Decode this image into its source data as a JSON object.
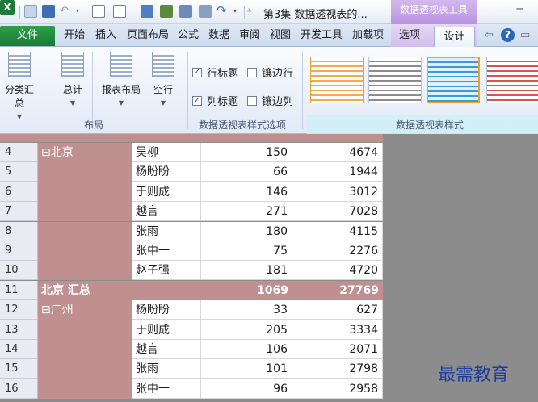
{
  "titlebar": {
    "app_icon": "X",
    "document_title": "第3集 数据透视表的...",
    "context_group": "数据透视表工具",
    "minimize": "−"
  },
  "tabs": {
    "file": "文件",
    "home": "开始",
    "insert": "插入",
    "page_layout": "页面布局",
    "formulas": "公式",
    "data": "数据",
    "review": "审阅",
    "view": "视图",
    "developer": "开发工具",
    "addins": "加载项",
    "options": "选项",
    "design": "设计"
  },
  "ribbon": {
    "subtotals": "分类汇总",
    "grand_totals": "总计",
    "report_layout": "报表布局",
    "blank_rows": "空行",
    "layout_group": "布局",
    "row_headers": "行标题",
    "banded_rows": "镶边行",
    "column_headers": "列标题",
    "banded_columns": "镶边列",
    "style_options_group": "数据透视表样式选项",
    "styles_group": "数据透视表样式",
    "row_headers_checked": true,
    "column_headers_checked": true,
    "banded_rows_checked": false,
    "banded_columns_checked": false
  },
  "sheet": {
    "rows": [
      {
        "row": "4",
        "city": "⊟北京",
        "name": "吴柳",
        "qty": "150",
        "amount": "4674"
      },
      {
        "row": "5",
        "city": "",
        "name": "杨盼盼",
        "qty": "66",
        "amount": "1944"
      },
      {
        "row": "6",
        "city": "",
        "name": "于则成",
        "qty": "146",
        "amount": "3012"
      },
      {
        "row": "7",
        "city": "",
        "name": "越言",
        "qty": "271",
        "amount": "7028"
      },
      {
        "row": "8",
        "city": "",
        "name": "张雨",
        "qty": "180",
        "amount": "4115"
      },
      {
        "row": "9",
        "city": "",
        "name": "张中一",
        "qty": "75",
        "amount": "2276"
      },
      {
        "row": "10",
        "city": "",
        "name": "赵子强",
        "qty": "181",
        "amount": "4720"
      },
      {
        "row": "11",
        "subtotal": "北京 汇总",
        "qty": "1069",
        "amount": "27769"
      },
      {
        "row": "12",
        "city": "⊟广州",
        "name": "杨盼盼",
        "qty": "33",
        "amount": "627"
      },
      {
        "row": "13",
        "city": "",
        "name": "于则成",
        "qty": "205",
        "amount": "3334"
      },
      {
        "row": "14",
        "city": "",
        "name": "越言",
        "qty": "106",
        "amount": "2071"
      },
      {
        "row": "15",
        "city": "",
        "name": "张雨",
        "qty": "101",
        "amount": "2798"
      },
      {
        "row": "16",
        "city": "",
        "name": "张中一",
        "qty": "96",
        "amount": "2958"
      }
    ]
  },
  "watermark": "最需教育",
  "colors": {
    "pivot_band": "#c09090",
    "file_tab": "#1f8a3a",
    "context_tab": "#b892e1"
  }
}
